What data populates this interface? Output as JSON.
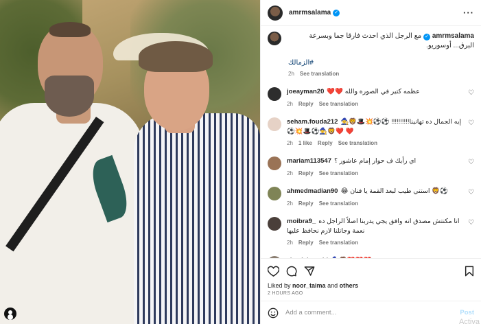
{
  "post": {
    "author": "amrmsalama",
    "caption": {
      "author": "amrmsalama",
      "text": "مع الرجل الذي احدث فارقا جما وبسرعة البرق... أوسوريو.",
      "hashtag": "#الزمالك",
      "age": "2h",
      "see_translation": "See translation"
    }
  },
  "comments": [
    {
      "user": "joeayman20",
      "text": "عظمه كتير في الصوره والله ❤️❤️",
      "age": "2h",
      "reply": "Reply",
      "see_translation": "See translation",
      "avatar_color": "#2d2d2d"
    },
    {
      "user": "seham.fouda212",
      "text": "إيه الجمال ده تهانينا!!!!!!!!!! ⚽⚽💥🎩🦁🧙❤️ ❤️🦁🧙⚽🎩💥⚽",
      "age": "2h",
      "likes": "1 like",
      "reply": "Reply",
      "see_translation": "See translation",
      "avatar_color": "#e6d2c6"
    },
    {
      "user": "mariam113547",
      "text": "اي رأيك ف حوار إمام عاشور ؟",
      "age": "2h",
      "reply": "Reply",
      "see_translation": "See translation",
      "avatar_color": "#9a7356"
    },
    {
      "user": "ahmedmadian90",
      "text": "⚽🦁 استني طيب لبعد القمة يا فنان 😂",
      "age": "2h",
      "reply": "Reply",
      "see_translation": "See translation",
      "avatar_color": "#7f8456"
    },
    {
      "user": "moibra9_",
      "text": "انا مكنتش مصدق انه وافق يجي يدربنا اصلاً الراجل ده نعمة وجاتلنا لازم نحافظ عليها",
      "age": "2h",
      "reply": "Reply",
      "see_translation": "See translation",
      "avatar_color": "#4a3f3a"
    },
    {
      "user": "ziaadahmedd",
      "text": "❤️❤️❤️🦁🧙",
      "age": "",
      "reply": "",
      "see_translation": "",
      "avatar_color": "#8a7d70"
    }
  ],
  "actions": {
    "liked_by_prefix": "Liked by",
    "liked_by_user": "noor_taima",
    "liked_by_and": "and",
    "liked_by_others": "others",
    "timestamp": "2 HOURS AGO",
    "add_comment_placeholder": "Add a comment...",
    "post_label": "Post"
  },
  "overlay": {
    "activate_text": "Activa"
  },
  "colors": {
    "link": "#00376b",
    "verified": "#0095f6",
    "muted": "#737373"
  },
  "icons": [
    "more-icon",
    "verified-icon",
    "heart-icon",
    "comment-icon",
    "share-icon",
    "bookmark-icon",
    "emoji-icon",
    "user-tag-icon"
  ]
}
